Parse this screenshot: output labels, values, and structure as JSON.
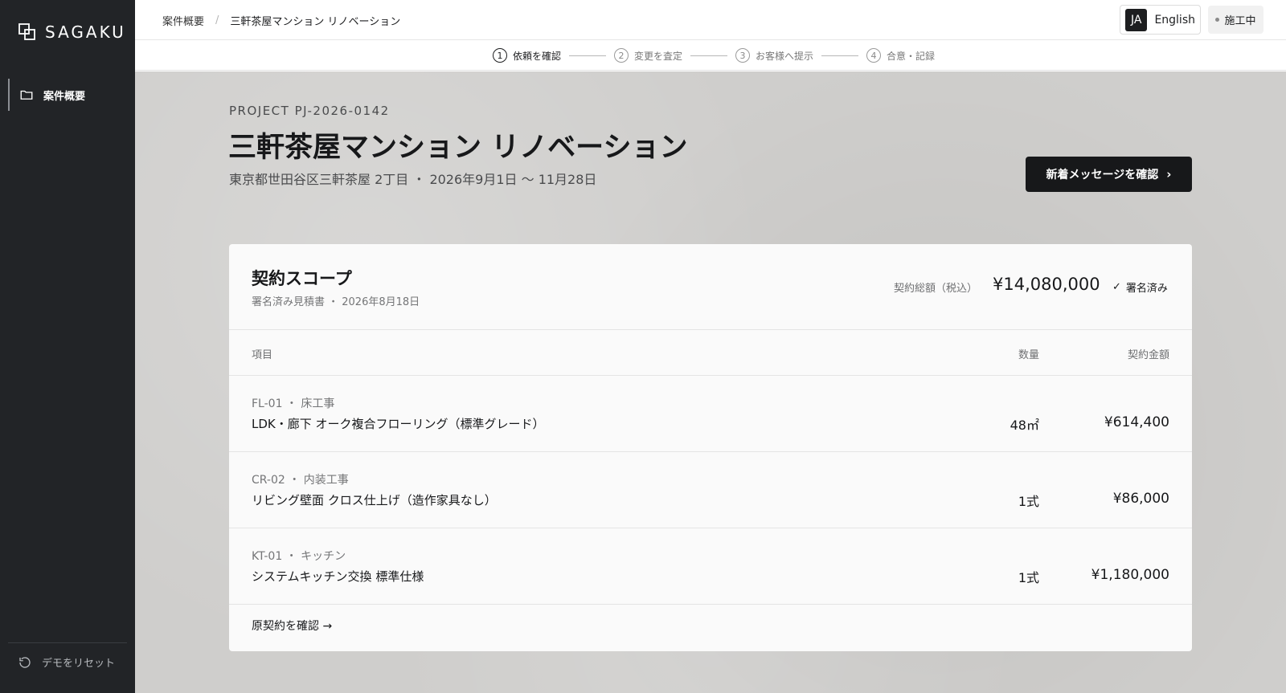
{
  "sidebar": {
    "brand": "SAGAKU",
    "nav": [
      {
        "label": "案件概要",
        "icon": "folder-icon"
      }
    ],
    "reset_label": "デモをリセット",
    "reset_icon": "reset-icon"
  },
  "topbar": {
    "breadcrumb": [
      "案件概要",
      "三軒茶屋マンション リノベーション"
    ],
    "separator": "/",
    "lang_code": "JA",
    "lang_name": "English",
    "status": "施工中"
  },
  "stepper": {
    "steps": [
      {
        "num": "1",
        "label": "依頼を確認"
      },
      {
        "num": "2",
        "label": "変更を査定"
      },
      {
        "num": "3",
        "label": "お客様へ提示"
      },
      {
        "num": "4",
        "label": "合意・記録"
      }
    ],
    "active_index": 0
  },
  "project": {
    "code": "PROJECT PJ-2026-0142",
    "title": "三軒茶屋マンション リノベーション",
    "subtitle": "東京都世田谷区三軒茶屋 2丁目 ・ 2026年9月1日 〜 11月28日",
    "cta_label": "新着メッセージを確認",
    "cta_icon": "chevron-right-icon"
  },
  "scope": {
    "title": "契約スコープ",
    "subtitle": "署名済み見積書 ・ 2026年8月18日",
    "total_label": "契約総額（税込）",
    "total_value": "¥14,080,000",
    "signed_label": "署名済み",
    "columns": {
      "item": "項目",
      "qty": "数量",
      "amount": "契約金額"
    },
    "rows": [
      {
        "meta": "FL-01 ・ 床工事",
        "name": "LDK・廊下 オーク複合フローリング（標準グレード）",
        "qty": "48㎡",
        "amount": "¥614,400"
      },
      {
        "meta": "CR-02 ・ 内装工事",
        "name": "リビング壁面 クロス仕上げ（造作家具なし）",
        "qty": "1式",
        "amount": "¥86,000"
      },
      {
        "meta": "KT-01 ・ キッチン",
        "name": "システムキッチン交換 標準仕様",
        "qty": "1式",
        "amount": "¥1,180,000"
      }
    ],
    "footer_link": "原契約を確認 →"
  },
  "colors": {
    "sidebar": "#222427",
    "accent": "#17181a",
    "background": "#cfcecc"
  }
}
